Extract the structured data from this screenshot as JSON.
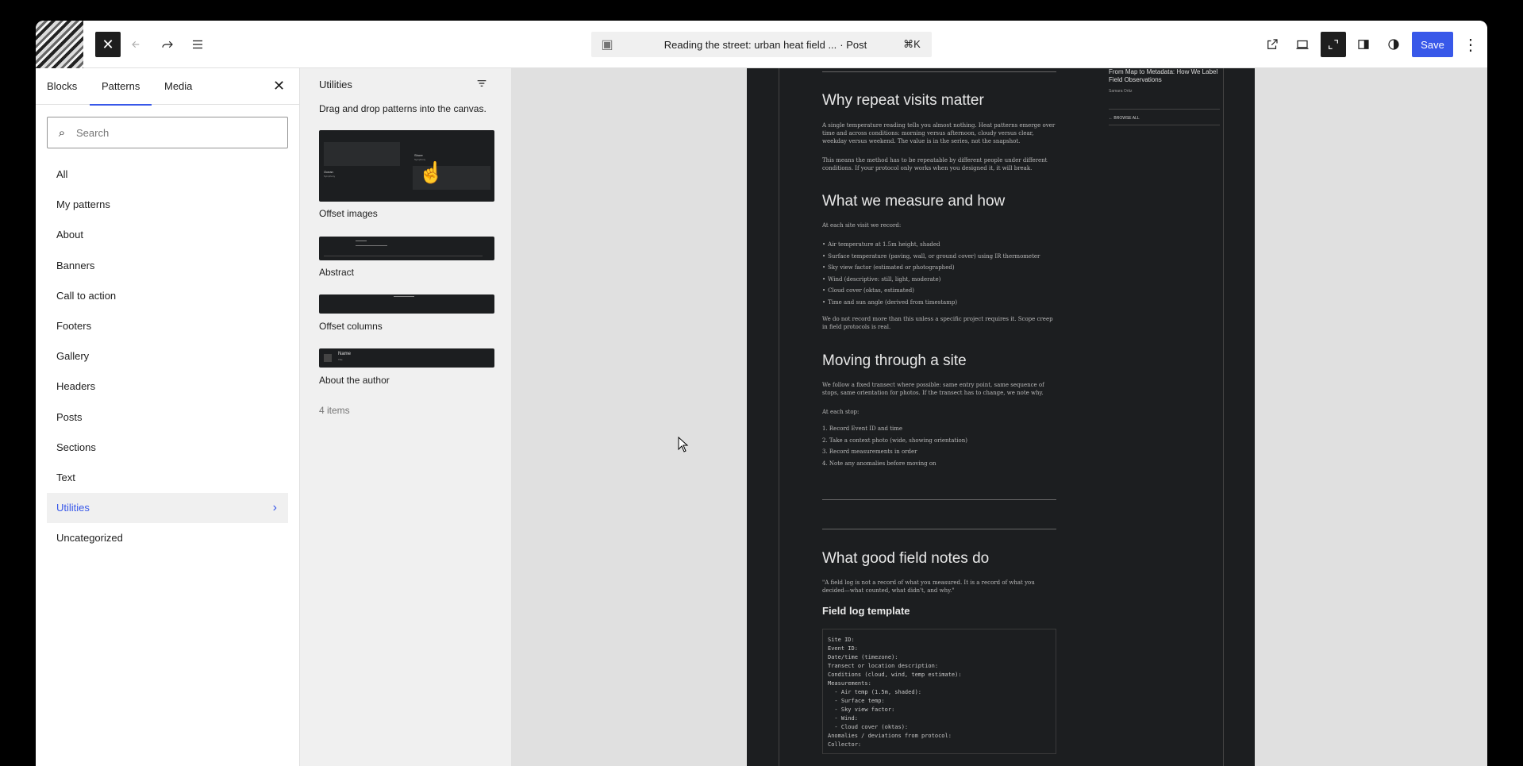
{
  "topbar": {
    "doc_title": "Reading the street: urban heat field ...",
    "doc_type": "· Post",
    "shortcut": "⌘K",
    "save_label": "Save",
    "icons": [
      "close-icon",
      "undo-icon",
      "redo-icon",
      "list-view-icon",
      "external-link-icon",
      "desktop-preview-icon",
      "fullscreen-icon",
      "sidebar-icon",
      "styles-icon",
      "more-options-icon"
    ]
  },
  "sidebar": {
    "tabs": [
      "Blocks",
      "Patterns",
      "Media"
    ],
    "search_placeholder": "Search",
    "categories": [
      "All",
      "My patterns",
      "About",
      "Banners",
      "Call to action",
      "Footers",
      "Gallery",
      "Headers",
      "Posts",
      "Sections",
      "Text",
      "Utilities",
      "Uncategorized"
    ],
    "active_category": "Utilities"
  },
  "patterns": {
    "title": "Utilities",
    "description": "Drag and drop patterns into the canvas.",
    "items": [
      "Offset images",
      "Abstract",
      "Offset columns",
      "About the author"
    ],
    "count": "4 items",
    "thumb_text": {
      "offset_images_1": "Shore",
      "offset_images_2": "Symphony",
      "offset_images_3": "Ocean",
      "offset_images_4": "Symphony",
      "about_author_name": "Name",
      "about_author_sub": "Title"
    }
  },
  "canvas": {
    "side": {
      "related_title": "From Map to Metadata: How We Label Field Observations",
      "author": "Samara Ortiz",
      "browse": "← BROWSE ALL"
    },
    "sections": {
      "s1_title": "Why repeat visits matter",
      "s1_p1": "A single temperature reading tells you almost nothing. Heat patterns emerge over time and across conditions: morning versus afternoon, cloudy versus clear, weekday versus weekend. The value is in the series, not the snapshot.",
      "s1_p2": "This means the method has to be repeatable by different people under different conditions. If your protocol only works when you designed it, it will break.",
      "s2_title": "What we measure and how",
      "s2_intro": "At each site visit we record:",
      "s2_items": [
        "Air temperature at 1.5m height, shaded",
        "Surface temperature (paving, wall, or ground cover) using IR thermometer",
        "Sky view factor (estimated or photographed)",
        "Wind (descriptive: still, light, moderate)",
        "Cloud cover (oktas, estimated)",
        "Time and sun angle (derived from timestamp)"
      ],
      "s2_p2": "We do not record more than this unless a specific project requires it. Scope creep in field protocols is real.",
      "s3_title": "Moving through a site",
      "s3_p1": "We follow a fixed transect where possible: same entry point, same sequence of stops, same orientation for photos. If the transect has to change, we note why.",
      "s3_intro": "At each stop:",
      "s3_items": [
        "1. Record Event ID and time",
        "2. Take a context photo (wide, showing orientation)",
        "3. Record measurements in order",
        "4. Note any anomalies before moving on"
      ],
      "s4_title": "What good field notes do",
      "s4_quote": "\"A field log is not a record of what you measured. It is a record of what you decided—what counted, what didn't, and why.\"",
      "s4_subtitle": "Field log template",
      "code_lines": [
        "Site ID:",
        "Event ID:",
        "Date/time (timezone):",
        "Transect or location description:",
        "Conditions (cloud, wind, temp estimate):",
        "Measurements:",
        "  - Air temp (1.5m, shaded):",
        "  - Surface temp:",
        "  - Sky view factor:",
        "  - Wind:",
        "  - Cloud cover (oktas):",
        "Anomalies / deviations from protocol:",
        "Collector:"
      ]
    }
  }
}
